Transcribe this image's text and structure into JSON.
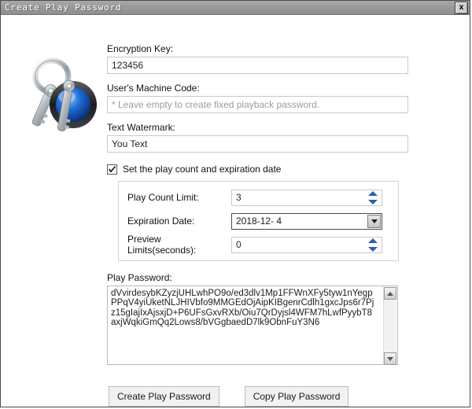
{
  "window": {
    "title": "Create Play Password",
    "close_label": "x"
  },
  "icon": {
    "name": "keyring-icon"
  },
  "form": {
    "encryption_key": {
      "label": "Encryption Key:",
      "value": "123456",
      "placeholder": ""
    },
    "machine_code": {
      "label": "User's Machine Code:",
      "value": "",
      "placeholder": "* Leave empty to create fixed playback password."
    },
    "text_watermark": {
      "label": "Text Watermark:",
      "value": "You Text",
      "placeholder": ""
    },
    "play_count_checkbox": {
      "label": "Set the play count and expiration date",
      "checked": true
    },
    "play_count_limit": {
      "label": "Play Count Limit:",
      "value": "3"
    },
    "expiration_date": {
      "label": "Expiration Date:",
      "value": "2018-12-  4"
    },
    "preview_limits": {
      "label": "Preview Limits(seconds):",
      "value": "0"
    }
  },
  "play_password": {
    "label": "Play Password:",
    "value": "dVvirdesybKZyzjUHLwhPO9o/ed3dlv1Mp1FFWnXFy5tyw1nYegpPPqV4yiUketNLJHIVbfo9MMGEdOjAipKIBgenrCdlh1gxcJps6r7Pjz15gIajIxAjsxjD+P6UFsGxvRXb/Oiu7QrDyjsl4WFM7hLwfPyybT8axjWqkiGmQq2Lows8/bVGgbaedD7lk9ObnFuY3N6"
  },
  "actions": {
    "create_label": "Create Play Password",
    "copy_label": "Copy Play Password"
  },
  "colors": {
    "titlebar": "#9a9a9a",
    "spinner_arrow": "#2f5fa8",
    "window_bg": "#ffffff"
  }
}
